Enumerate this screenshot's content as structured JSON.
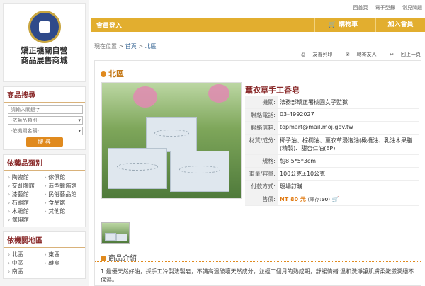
{
  "site": {
    "title_line1": "矯正機關自營",
    "title_line2": "商品展售商城"
  },
  "top_links": [
    "回首頁",
    "電子型錄",
    "常見問題"
  ],
  "nav": {
    "member_login": "會員登入",
    "cart": "購物車",
    "join": "加入會員"
  },
  "breadcrumb": {
    "prefix": "現在位置",
    "home": "首頁",
    "sep": ">",
    "current": "北區"
  },
  "tools": [
    "友善列印",
    "轉寄友人",
    "回上一頁"
  ],
  "search": {
    "title": "商品搜尋",
    "keyword_placeholder": "請輸入關鍵字",
    "category_select": "-依藝品類別-",
    "agency_select": "-依機關名稱-",
    "button": "搜 尋"
  },
  "categories": {
    "title": "依藝品類別",
    "items": [
      "陶瓷館",
      "傢俱館",
      "交趾陶館",
      "造型蠟燭館",
      "漆藝館",
      "民俗藝品館",
      "石雕館",
      "食品館",
      "木雕館",
      "其他館",
      "傢俱館"
    ]
  },
  "regions": {
    "title": "依機關地區",
    "items": [
      "北區",
      "東區",
      "中區",
      "離島",
      "南區"
    ]
  },
  "main": {
    "region_title": "北區",
    "product_name": "薰衣草手工香皂",
    "rows": [
      {
        "label": "機關:",
        "value": "法務部矯正署桃園女子監獄"
      },
      {
        "label": "聯絡電話:",
        "value": "03-4992027"
      },
      {
        "label": "聯絡信箱:",
        "value": "topmart@mail.moj.gov.tw"
      },
      {
        "label": "材質/成分:",
        "value": "椰子油、棕櫚油、薰衣草浸泡油(橄欖油、乳油木果脂(精製)、甜杏仁油(EP)"
      },
      {
        "label": "規格:",
        "value": "約8.5*5*3cm"
      },
      {
        "label": "重量/容量:",
        "value": "100公克±10公克"
      },
      {
        "label": "付款方式:",
        "value": "現場訂購"
      },
      {
        "label": "售價:",
        "value": "NT 80 元",
        "stock_label": "(庫存:",
        "stock_value": "50",
        "stock_end": ")"
      }
    ],
    "intro_title": "商品介紹",
    "intro_text": "1.最優天然好油，採手工冷製法製皂，不講高溫破壞天然成分，並經二個月的熟成期，舒緩情緒 溫和洗淨讓肌膚柔嫩滋潤絕不保濕。"
  },
  "colors": {
    "gold": "#e2ae2f",
    "accent": "#e08a1e",
    "maroon": "#8a2b2b"
  }
}
